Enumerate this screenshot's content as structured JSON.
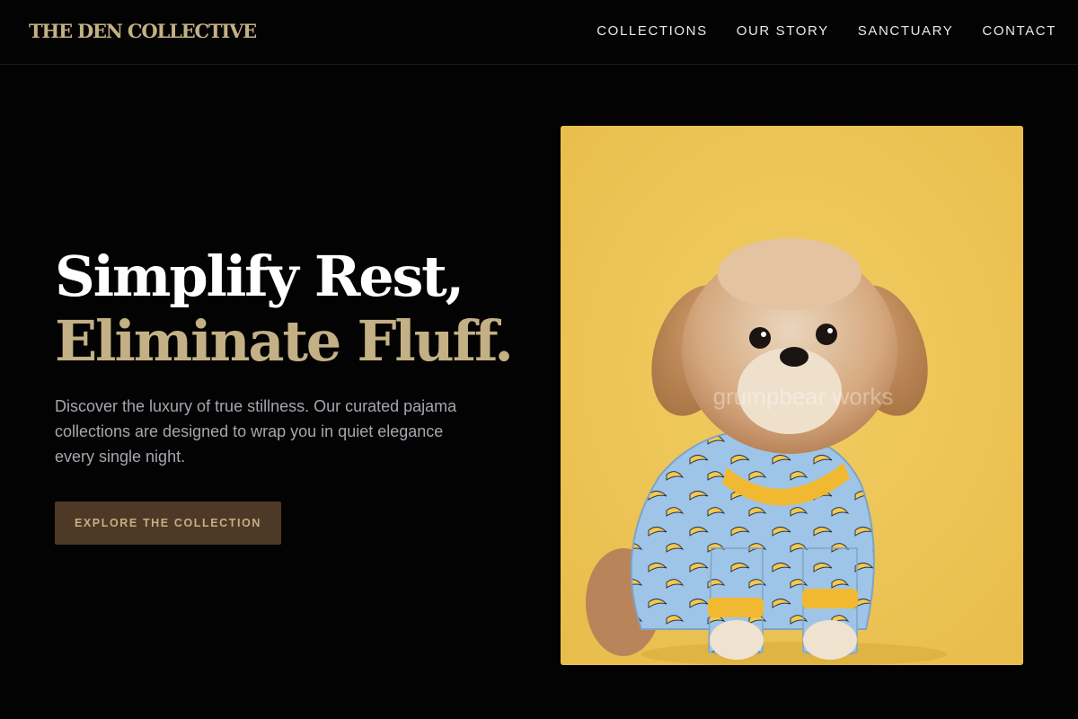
{
  "brand": {
    "name": "THE DEN COLLECTIVE",
    "accent_color": "#c3b084",
    "background_color": "#030303"
  },
  "nav": {
    "items": [
      {
        "label": "COLLECTIONS"
      },
      {
        "label": "OUR STORY"
      },
      {
        "label": "SANCTUARY"
      },
      {
        "label": "CONTACT"
      }
    ]
  },
  "hero": {
    "headline_line1": "Simplify Rest,",
    "headline_line2": "Eliminate Fluff.",
    "description": "Discover the luxury of true stillness. Our curated pajama collections are designed to wrap you in quiet elegance every single night.",
    "cta_label": "EXPLORE THE COLLECTION",
    "cta_color": "#4e3826",
    "image": {
      "subject": "small fluffy dog wearing blue banana-print pajamas on a yellow background",
      "watermark": "grumpbear works",
      "background_color": "#edc454"
    }
  }
}
